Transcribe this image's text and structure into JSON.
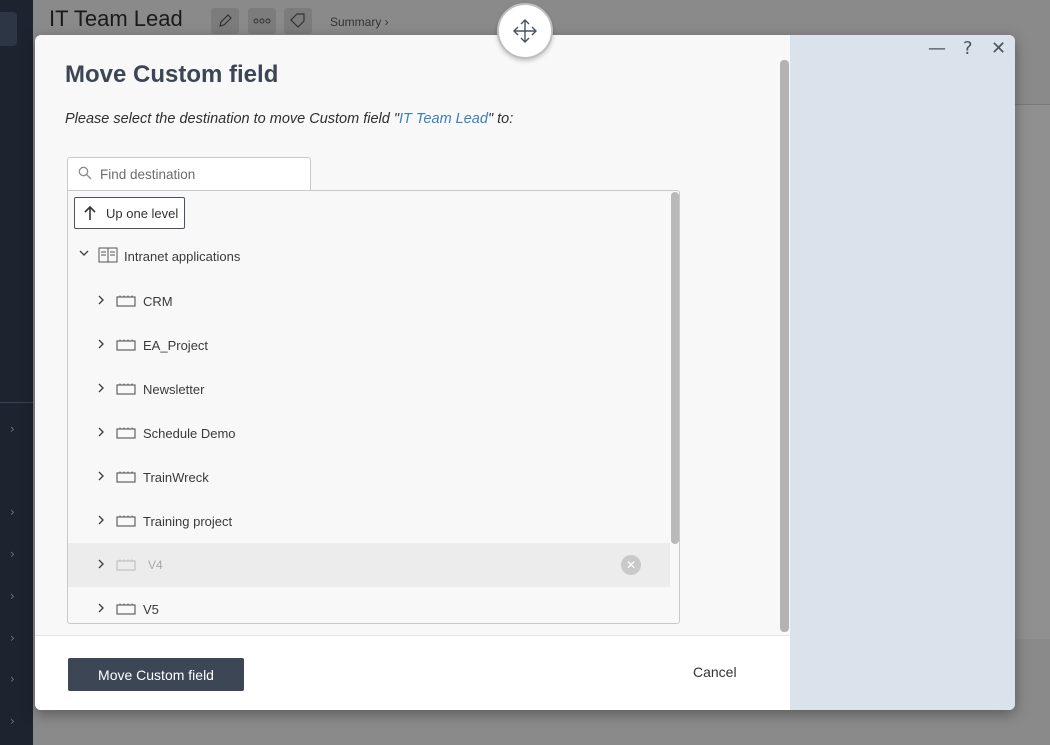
{
  "background": {
    "title": "IT Team Lead",
    "breadcrumb": "Summary ›",
    "header_icons": [
      "pencil-icon",
      "more-icon",
      "tag-icon"
    ]
  },
  "modal": {
    "title": "Move Custom field",
    "description_prefix": "Please select the destination to move Custom field \"",
    "field_name": "IT Team Lead",
    "description_suffix": "\" to:",
    "window_controls": {
      "minimize": "—",
      "help": "?",
      "close": "✕"
    },
    "search": {
      "placeholder": "Find destination",
      "value": ""
    },
    "up_button_label": "Up one level",
    "tree": {
      "root": {
        "label": "Intranet applications",
        "expanded": true,
        "icon": "application-icon"
      },
      "children": [
        {
          "label": "CRM",
          "icon": "project-icon",
          "disabled": false
        },
        {
          "label": "EA_Project",
          "icon": "project-icon",
          "disabled": false
        },
        {
          "label": "Newsletter",
          "icon": "project-icon",
          "disabled": false
        },
        {
          "label": "Schedule Demo",
          "icon": "project-icon",
          "disabled": false
        },
        {
          "label": "TrainWreck",
          "icon": "project-icon",
          "disabled": false
        },
        {
          "label": "Training project",
          "icon": "project-icon",
          "disabled": false
        },
        {
          "label": "V4",
          "icon": "project-icon",
          "disabled": true
        },
        {
          "label": "V5",
          "icon": "project-icon",
          "disabled": false
        }
      ]
    },
    "footer": {
      "primary_label": "Move Custom field",
      "cancel_label": "Cancel"
    }
  },
  "colors": {
    "primary": "#3d4654",
    "link": "#3a7fc1",
    "side_panel": "#dae2ec",
    "overlay": "#8a8a8a"
  }
}
